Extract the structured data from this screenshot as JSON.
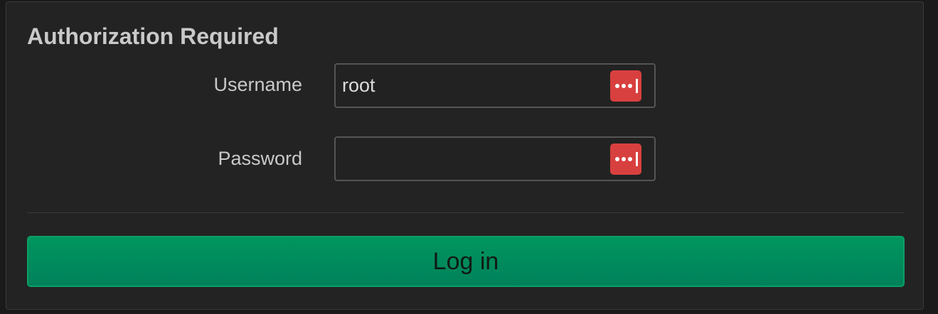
{
  "form": {
    "title": "Authorization Required",
    "username": {
      "label": "Username",
      "value": "root",
      "icon": "lastpass-icon"
    },
    "password": {
      "label": "Password",
      "value": "",
      "icon": "lastpass-icon"
    },
    "submit_label": "Log in"
  },
  "colors": {
    "background": "#232323",
    "text": "#c9c9c9",
    "input_border": "#555555",
    "lastpass_icon": "#d8403f",
    "button": "#00965f"
  }
}
